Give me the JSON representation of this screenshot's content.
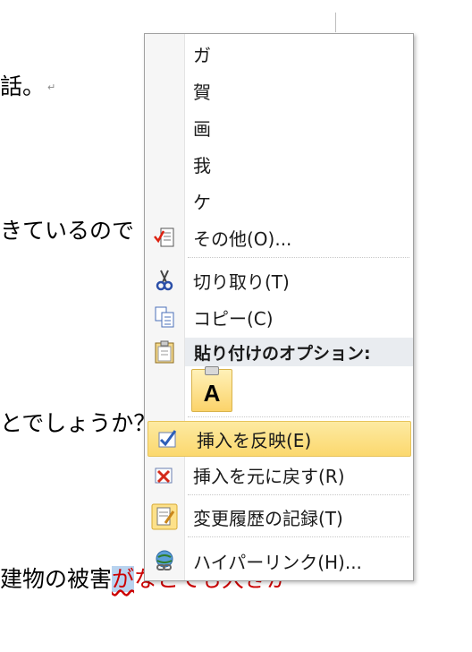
{
  "document": {
    "lines": [
      "話。",
      "きているので",
      "とでしょうか？",
      "建物の被害",
      "が",
      "なとても大きか"
    ],
    "pilcrow": "↵"
  },
  "menu": {
    "suggestions": [
      "ガ",
      "賀",
      "画",
      "我",
      "ケ"
    ],
    "more": "その他(O)...",
    "cut": "切り取り(T)",
    "copy": "コピー(C)",
    "paste_options_header": "貼り付けのオプション:",
    "paste_keep_text": "A",
    "accept_insert": "挿入を反映(E)",
    "reject_insert": "挿入を元に戻す(R)",
    "track_changes": "変更履歴の記録(T)",
    "hyperlink": "ハイパーリンク(H)..."
  },
  "colors": {
    "highlight": "#fbd86e",
    "spelling_error": "#cc0000",
    "selection": "#b8d3ef"
  }
}
